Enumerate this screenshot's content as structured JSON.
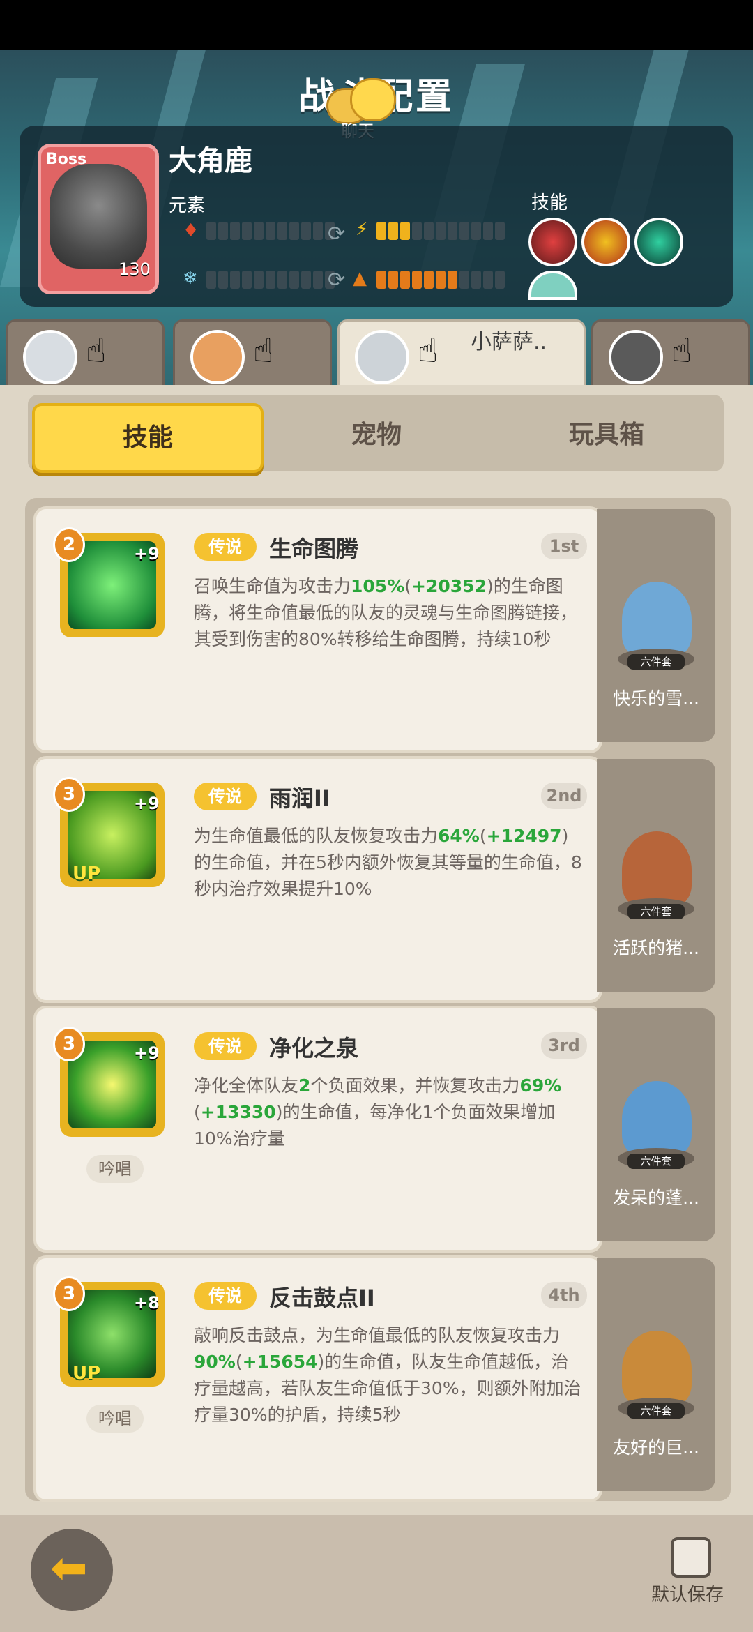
{
  "header": {
    "title": "战斗配置",
    "chat_label": "聊天"
  },
  "boss": {
    "tag": "Boss",
    "name": "大角鹿",
    "level": "130",
    "element_label": "元素",
    "skill_label": "技能"
  },
  "heroes": [
    {
      "name": ""
    },
    {
      "name": ""
    },
    {
      "name": "小萨萨.."
    },
    {
      "name": ""
    }
  ],
  "tabs": {
    "skills": "技能",
    "pets": "宠物",
    "toybox": "玩具箱"
  },
  "skills": [
    {
      "level": "2",
      "bonus": "+9",
      "up": false,
      "chant": "",
      "rarity": "传说",
      "name": "生命图腾",
      "rank": "1st",
      "desc_parts": [
        "召唤生命值为攻击力",
        "105%",
        "(",
        "+20352",
        ")的生命图腾，将生命值最低的队友的灵魂与生命图腾链接，其受到伤害的80%转移给生命图腾，持续10秒"
      ]
    },
    {
      "level": "3",
      "bonus": "+9",
      "up": true,
      "chant": "",
      "rarity": "传说",
      "name": "雨润II",
      "rank": "2nd",
      "desc_parts": [
        "为生命值最低的队友恢复攻击力",
        "64%",
        "(",
        "+12497",
        ")的生命值，并在5秒内额外恢复其等量的生命值，8秒内治疗效果提升10%"
      ]
    },
    {
      "level": "3",
      "bonus": "+9",
      "up": false,
      "chant": "吟唱",
      "rarity": "传说",
      "name": "净化之泉",
      "rank": "3rd",
      "desc_parts": [
        "净化全体队友",
        "2",
        "个负面效果，并恢复攻击力",
        "69%",
        "(",
        "+13330",
        ")的生命值，每净化1个负面效果增加10%治疗量"
      ]
    },
    {
      "level": "3",
      "bonus": "+8",
      "up": true,
      "chant": "吟唱",
      "rarity": "传说",
      "name": "反击鼓点II",
      "rank": "4th",
      "desc_parts": [
        "敲响反击鼓点，为生命值最低的队友恢复攻击力",
        "90%",
        "(",
        "+15654",
        ")的生命值，队友生命值越低，治疗量越高，若队友生命值低于30%，则额外附加治疗量30%的护盾，持续5秒"
      ]
    }
  ],
  "pets": [
    {
      "name": "快乐的雪...",
      "set": "六件套",
      "color": "#6fa8d6"
    },
    {
      "name": "活跃的猪...",
      "set": "六件套",
      "color": "#b7653a"
    },
    {
      "name": "发呆的蓬...",
      "set": "六件套",
      "color": "#5c9ad0"
    },
    {
      "name": "友好的巨...",
      "set": "六件套",
      "color": "#c98a3a"
    }
  ],
  "footer": {
    "save_label": "默认保存"
  },
  "colors": {
    "accent": "#ffd84a",
    "green": "#2aa63a",
    "rarity": "#f5c230"
  }
}
